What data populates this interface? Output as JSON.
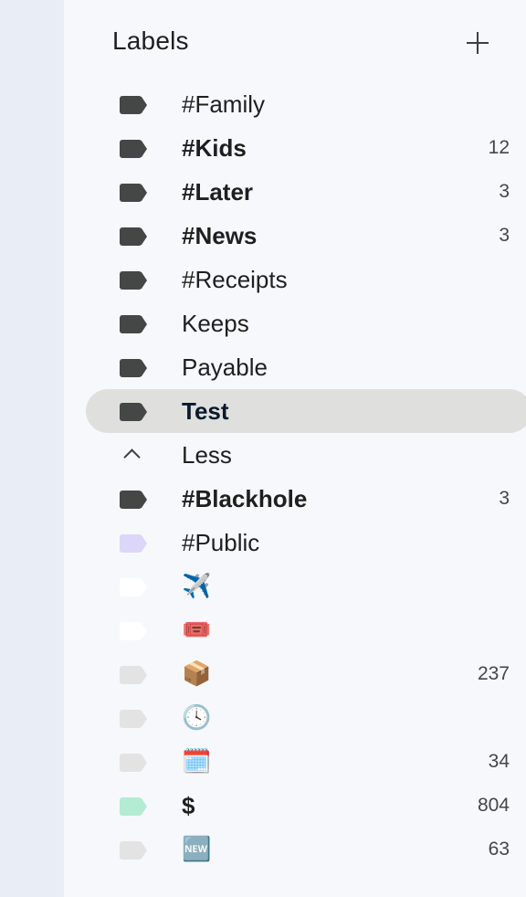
{
  "header": {
    "title": "Labels"
  },
  "colors": {
    "rail": "#e9eef6",
    "panel": "#f6f8fc",
    "active_row": "#dfe0de",
    "tag_default": "#444746"
  },
  "labels": [
    {
      "label": "#Family",
      "count": "",
      "bold": false,
      "tag_color": "#444746",
      "icon": "label-icon"
    },
    {
      "label": "#Kids",
      "count": "12",
      "bold": true,
      "tag_color": "#444746",
      "icon": "label-icon"
    },
    {
      "label": "#Later",
      "count": "3",
      "bold": true,
      "tag_color": "#444746",
      "icon": "label-icon"
    },
    {
      "label": "#News",
      "count": "3",
      "bold": true,
      "tag_color": "#444746",
      "icon": "label-icon"
    },
    {
      "label": "#Receipts",
      "count": "",
      "bold": false,
      "tag_color": "#444746",
      "icon": "label-icon"
    },
    {
      "label": "Keeps",
      "count": "",
      "bold": false,
      "tag_color": "#444746",
      "icon": "label-icon"
    },
    {
      "label": "Payable",
      "count": "",
      "bold": false,
      "tag_color": "#444746",
      "icon": "label-icon"
    },
    {
      "label": "Test",
      "count": "",
      "bold": true,
      "tag_color": "#444746",
      "icon": "label-icon",
      "active": true
    }
  ],
  "less": {
    "label": "Less",
    "icon": "chevron-up-icon"
  },
  "more_labels": [
    {
      "label": "#Blackhole",
      "count": "3",
      "bold": true,
      "tag_color": "#444746",
      "icon": "label-icon"
    },
    {
      "label": "#Public",
      "count": "",
      "bold": false,
      "tag_color": "#dcd6fb",
      "icon": "label-icon"
    },
    {
      "label": "✈️",
      "count": "",
      "bold": false,
      "tag_color": "#ffffff",
      "icon": "airplane-emoji"
    },
    {
      "label": "🎟️",
      "count": "",
      "bold": false,
      "tag_color": "#ffffff",
      "icon": "ticket-emoji"
    },
    {
      "label": "📦",
      "count": "237",
      "bold": false,
      "tag_color": "#e3e3e3",
      "icon": "package-emoji"
    },
    {
      "label": "🕓",
      "count": "",
      "bold": false,
      "tag_color": "#e3e3e3",
      "icon": "clock-emoji"
    },
    {
      "label": "🗓️",
      "count": "34",
      "bold": false,
      "tag_color": "#e3e3e3",
      "icon": "calendar-emoji"
    },
    {
      "label": "$",
      "count": "804",
      "bold": true,
      "tag_color": "#b3ecd3",
      "icon": "label-icon"
    },
    {
      "label": "🆕",
      "count": "63",
      "bold": false,
      "tag_color": "#e3e3e3",
      "icon": "new-emoji"
    }
  ]
}
